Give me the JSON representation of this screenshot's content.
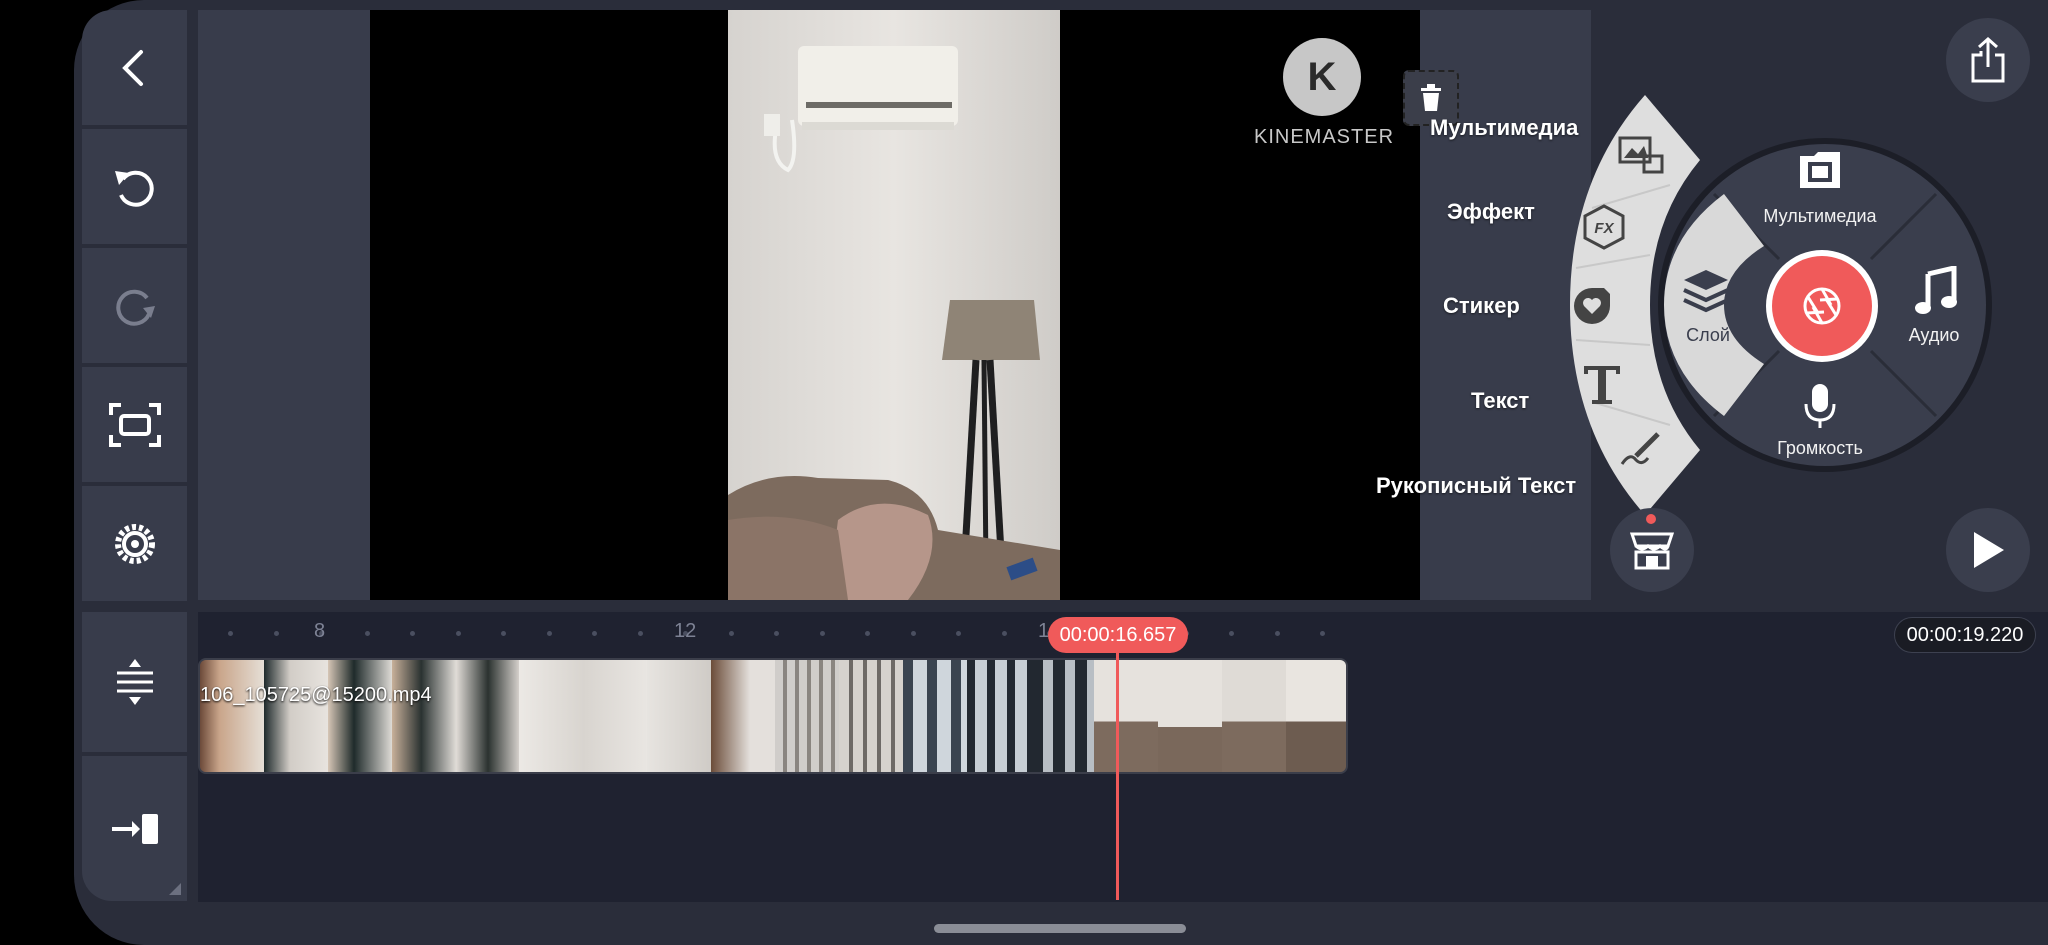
{
  "left_toolbar": {
    "back": "back-icon",
    "undo": "undo-icon",
    "redo": "redo-icon",
    "capture": "capture-icon",
    "settings": "settings-icon",
    "timeline_expand": "timeline-expand-icon",
    "jump_to_end": "jump-to-end-icon"
  },
  "preview": {
    "watermark_brand": "KINEMASTER",
    "delete_icon": "trash-icon"
  },
  "layer_menu": {
    "items": [
      {
        "label": "Мультимедиа",
        "icon": "image-media-icon"
      },
      {
        "label": "Эффект",
        "icon": "fx-icon"
      },
      {
        "label": "Стикер",
        "icon": "sticker-icon"
      },
      {
        "label": "Текст",
        "icon": "text-icon"
      },
      {
        "label": "Рукописный Текст",
        "icon": "handwriting-icon"
      }
    ]
  },
  "main_wheel": {
    "media": "Мультимедиа",
    "layer": "Слой",
    "audio": "Аудио",
    "voice": "Громкость"
  },
  "timeline": {
    "ruler_labels": [
      "8",
      "12",
      "1"
    ],
    "playhead_time": "00:00:16.657",
    "total_duration": "00:00:19.220",
    "clip_name": "106_105725@15200.mp4"
  },
  "colors": {
    "accent": "#f05a5a",
    "panel": "#383c4b",
    "background": "#2a2d3a",
    "timeline": "#1f2230"
  }
}
